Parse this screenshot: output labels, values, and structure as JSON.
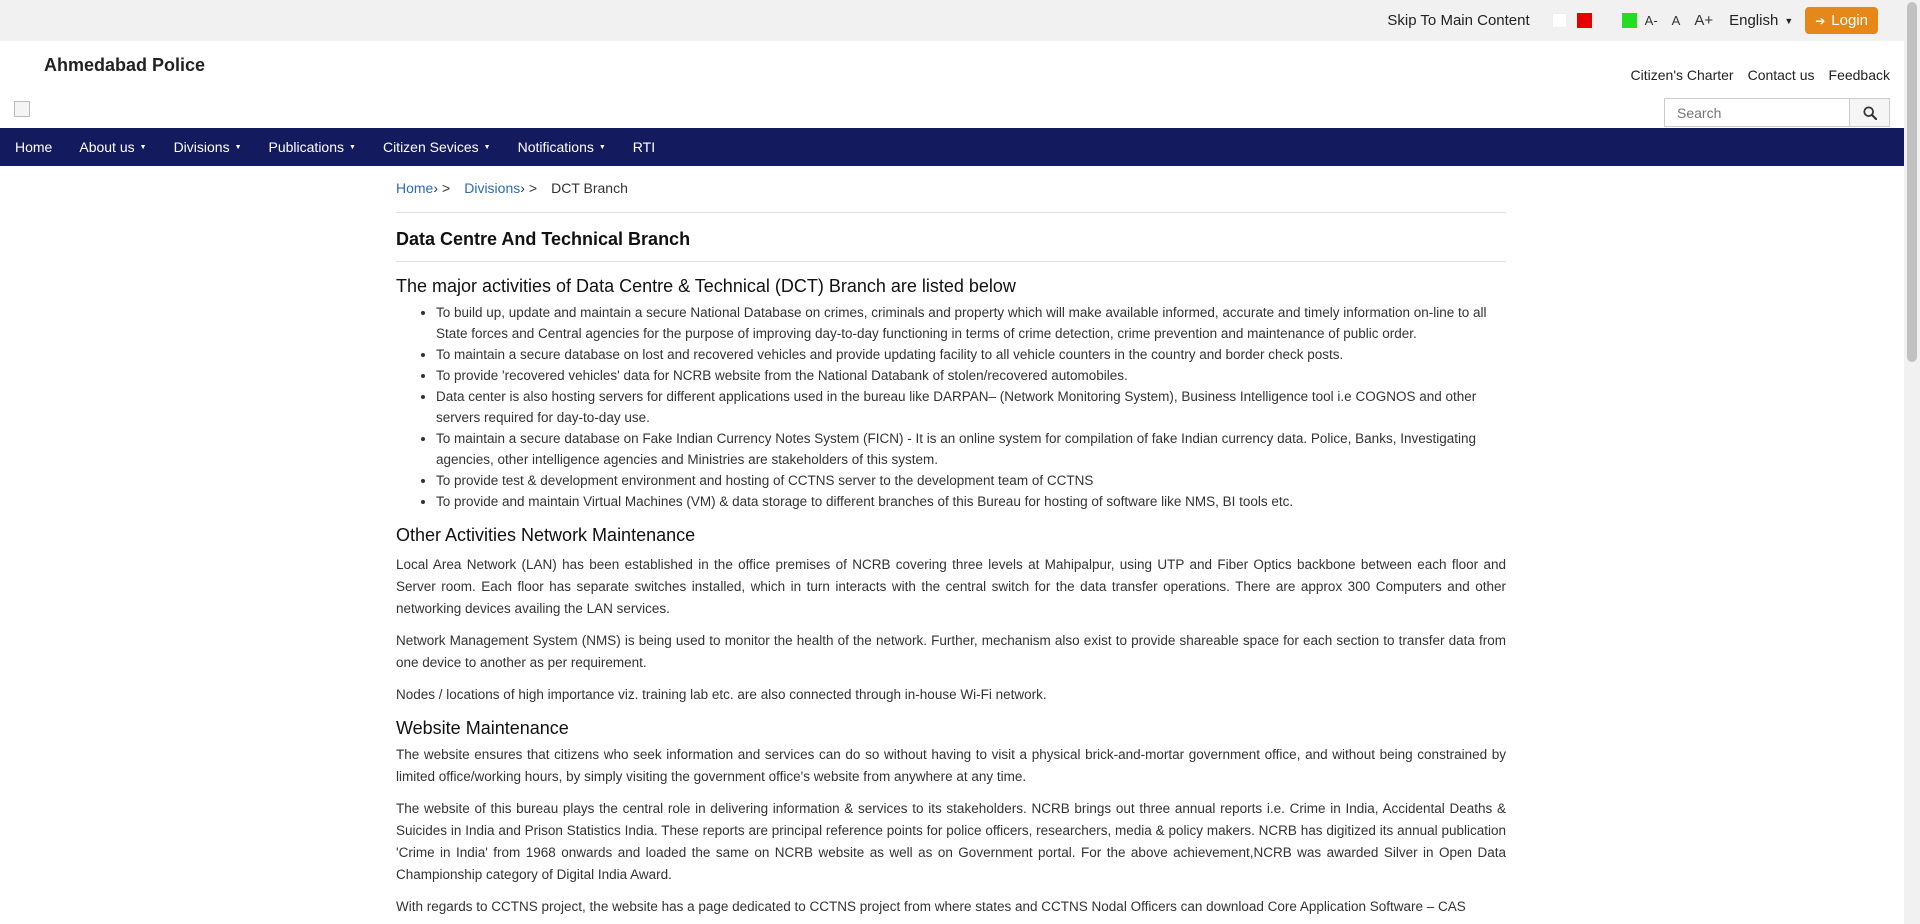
{
  "topbar": {
    "skip": "Skip To Main Content",
    "font_small": "A-",
    "font_normal": "A",
    "font_large": "A+",
    "language": "English",
    "login": "Login"
  },
  "header": {
    "site_title": "Ahmedabad Police",
    "links": [
      "Citizen's Charter",
      "Contact us",
      "Feedback"
    ],
    "search_placeholder": "Search"
  },
  "nav": [
    {
      "label": "Home",
      "dropdown": false
    },
    {
      "label": "About us",
      "dropdown": true
    },
    {
      "label": "Divisions",
      "dropdown": true
    },
    {
      "label": "Publications",
      "dropdown": true
    },
    {
      "label": "Citizen Sevices",
      "dropdown": true
    },
    {
      "label": "Notifications",
      "dropdown": true
    },
    {
      "label": "RTI",
      "dropdown": false
    }
  ],
  "breadcrumb": {
    "home": "Home",
    "divisions": "Divisions",
    "current": "DCT Branch",
    "sep": ">"
  },
  "page_title": "Data Centre And Technical Branch",
  "major": {
    "heading": "The major activities of Data Centre & Technical (DCT) Branch are listed below",
    "items": [
      "To build up, update and maintain a secure National Database on crimes, criminals and property which will make available informed, accurate and timely information on-line to all State forces and Central agencies for the purpose of improving day-to-day functioning in terms of crime detection, crime prevention and maintenance of public order.",
      "To maintain a secure database on lost and recovered vehicles and provide updating facility to all vehicle counters in the country and border check posts.",
      "To provide 'recovered vehicles' data for NCRB website from the National Databank of stolen/recovered automobiles.",
      "Data center is also hosting servers for different applications used in the bureau like DARPAN– (Network Monitoring System), Business Intelligence tool i.e COGNOS and other servers required for day-to-day use.",
      "To maintain a secure database on Fake Indian Currency Notes System (FICN) - It is an online system for compilation of fake Indian currency data. Police, Banks, Investigating agencies, other intelligence agencies and Ministries are stakeholders of this system.",
      "To provide test & development environment and hosting of CCTNS server to the development team of CCTNS",
      "To provide and maintain Virtual Machines (VM) & data storage to different branches of this Bureau for hosting of software like NMS, BI tools etc."
    ]
  },
  "other": {
    "heading": "Other Activities Network Maintenance",
    "paragraphs": [
      "Local Area Network (LAN) has been established in the office premises of NCRB covering three levels at Mahipalpur, using UTP and Fiber Optics backbone between each floor and Server room. Each floor has separate switches installed, which in turn interacts with the central switch for the data transfer operations. There are approx 300 Computers and other networking devices availing the LAN services.",
      "Network Management System (NMS) is being used to monitor the health of the network. Further, mechanism also exist to provide shareable space for each section to transfer data from one device to another as per requirement.",
      "Nodes / locations of high importance viz. training lab etc. are also connected through in-house Wi-Fi network."
    ]
  },
  "website": {
    "heading": "Website Maintenance",
    "paragraphs": [
      "The website ensures that citizens who seek information and services can do so without having to visit a physical brick-and-mortar government office, and without being constrained by limited office/working hours, by simply visiting the government office's website from anywhere at any time.",
      "The website of this bureau plays the central role in delivering information & services to its stakeholders. NCRB brings out three annual reports i.e. Crime in India, Accidental Deaths & Suicides in India and Prison Statistics India. These reports are principal reference points for police officers, researchers, media & policy makers. NCRB has digitized its annual publication 'Crime in India' from 1968 onwards and loaded the same on NCRB website as well as on Government portal. For the above achievement,NCRB was awarded Silver in Open Data Championship category of Digital India Award.",
      "With regards to CCTNS project, the website has a page dedicated to CCTNS project from where states and CCTNS Nodal Officers can download Core Application Software – CAS"
    ]
  },
  "colors": {
    "nav_bg": "#141a5e",
    "login_bg": "#e6871a",
    "link": "#2a6db5",
    "contrast_red": "#e60000",
    "contrast_green": "#22dd22"
  },
  "icons": {
    "login": "sign-in-icon",
    "search": "search-icon",
    "logo": "broken-image-icon"
  }
}
